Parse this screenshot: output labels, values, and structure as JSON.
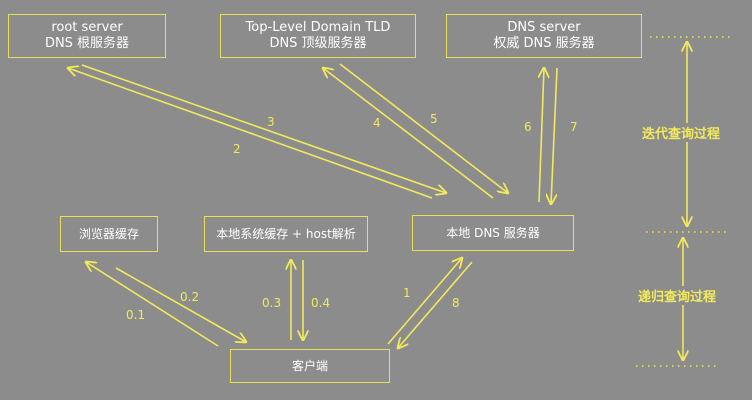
{
  "colors": {
    "background": "#8c8c8c",
    "line": "#f2ea5c",
    "text": "#ffffff"
  },
  "nodes": {
    "root_server": {
      "line1": "root server",
      "line2": "DNS 根服务器"
    },
    "tld_server": {
      "line1": "Top-Level Domain TLD",
      "line2": "DNS 顶级服务器"
    },
    "auth_server": {
      "line1": "DNS server",
      "line2": "权威 DNS 服务器"
    },
    "browser_cache": {
      "label": "浏览器缓存"
    },
    "system_cache": {
      "label": "本地系统缓存 + host解析"
    },
    "local_dns": {
      "label": "本地 DNS 服务器"
    },
    "client": {
      "label": "客户端"
    }
  },
  "steps": {
    "s1": "1",
    "s8": "8",
    "s01": "0.1",
    "s02": "0.2",
    "s03": "0.3",
    "s04": "0.4",
    "s2": "2",
    "s3": "3",
    "s4": "4",
    "s5": "5",
    "s6": "6",
    "s7": "7"
  },
  "phases": {
    "iterative": "迭代查询过程",
    "recursive": "递归查询过程"
  }
}
